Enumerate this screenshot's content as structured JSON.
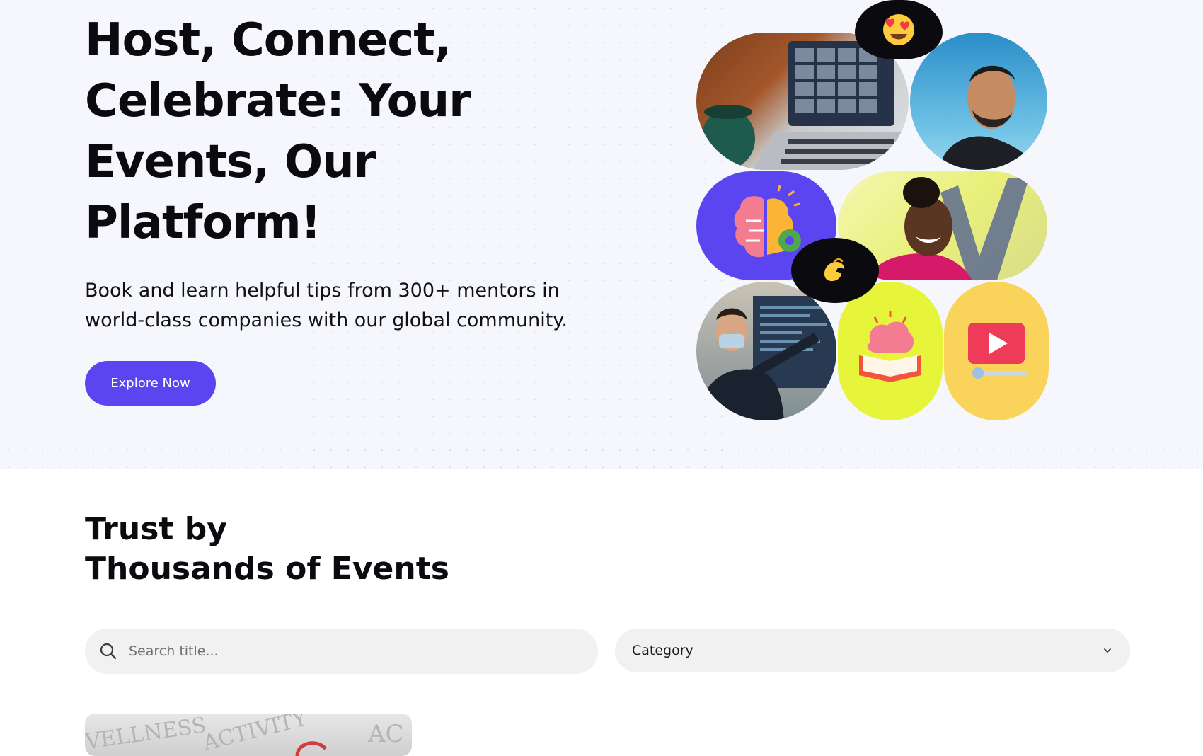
{
  "hero": {
    "title": "Host, Connect, Celebrate: Your Events, Our Platform!",
    "subtitle": "Book and learn helpful tips from 300+ mentors in world-class companies with our global community.",
    "cta_label": "Explore Now"
  },
  "trust": {
    "title_line1": "Trust by",
    "title_line2": "Thousands of Events"
  },
  "search": {
    "placeholder": "Search title..."
  },
  "category": {
    "selected": "Category"
  },
  "colors": {
    "accent": "#5b45f0",
    "hero_bg": "#f6f7fc",
    "yellow_green": "#e6f53a",
    "yellow": "#f9d35a"
  },
  "icons": {
    "search": "search-icon",
    "dropdown": "chevron-down-icon",
    "emoji_heart_eyes": "heart-eyes-emoji-icon",
    "emoji_pinch": "pinching-hand-emoji-icon",
    "brain_idea": "brain-lightbulb-icon",
    "brain_book": "brain-book-icon",
    "video_play": "video-play-icon"
  }
}
